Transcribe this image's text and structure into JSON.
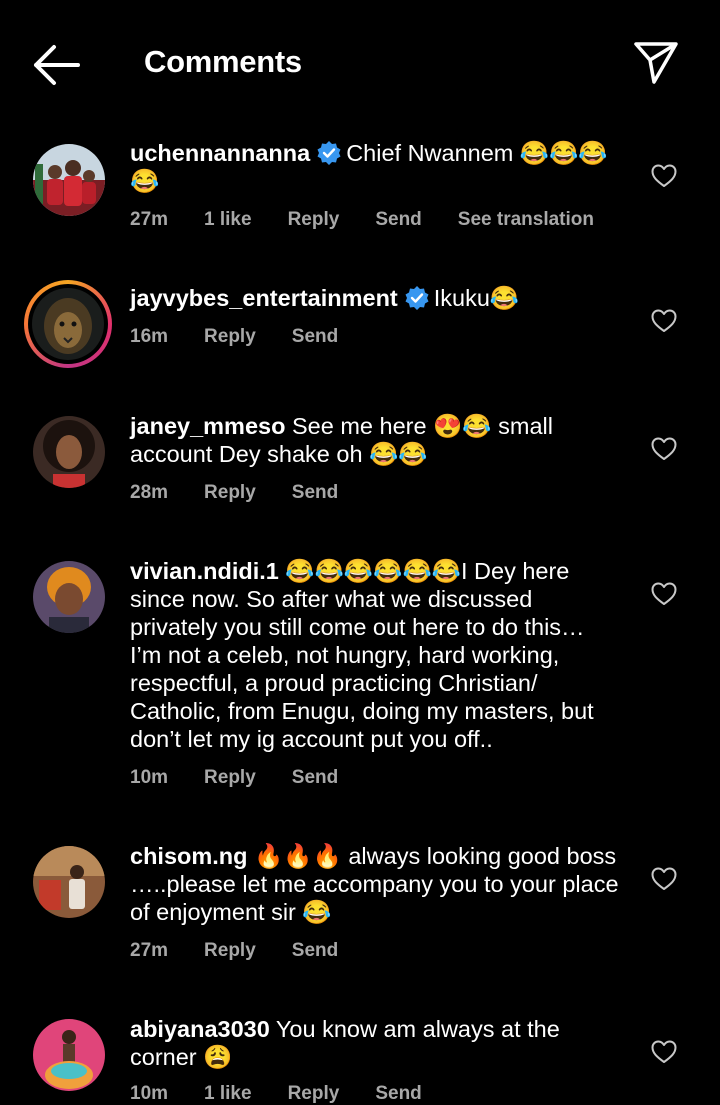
{
  "header": {
    "title": "Comments",
    "back_icon": "arrow-left-icon",
    "share_icon": "paper-plane-icon"
  },
  "comments": [
    {
      "username": "uchennannanna",
      "verified": true,
      "text": "Chief Nwannem 😂😂😂😂",
      "time": "27m",
      "likes": "1 like",
      "reply": "Reply",
      "send": "Send",
      "translate": "See translation"
    },
    {
      "username": "jayvybes_entertainment",
      "verified": true,
      "text": "Ikuku😂",
      "time": "16m",
      "reply": "Reply",
      "send": "Send"
    },
    {
      "username": "janey_mmeso",
      "verified": false,
      "text": "See me here 😍😂 small account Dey shake oh 😂😂",
      "time": "28m",
      "reply": "Reply",
      "send": "Send"
    },
    {
      "username": "vivian.ndidi.1",
      "verified": false,
      "text": "😂😂😂😂😂😂I Dey here since now. So after what we discussed privately you still come out here to do this… I’m not a celeb, not hungry, hard working, respectful, a proud practicing Christian/ Catholic, from Enugu, doing my masters, but don’t let my ig account put you off..",
      "time": "10m",
      "reply": "Reply",
      "send": "Send"
    },
    {
      "username": "chisom.ng",
      "verified": false,
      "text": "🔥🔥🔥 always looking good boss …..please let me accompany you to your place of enjoyment sir 😂",
      "time": "27m",
      "reply": "Reply",
      "send": "Send"
    },
    {
      "username": "abiyana3030",
      "verified": false,
      "text": "You know am always at the corner 😩",
      "time": "10m",
      "likes": "1 like",
      "reply": "Reply",
      "send": "Send"
    }
  ],
  "colors": {
    "background": "#000000",
    "text": "#ffffff",
    "secondary": "#a8a8a8",
    "verified": "#3897f0"
  }
}
